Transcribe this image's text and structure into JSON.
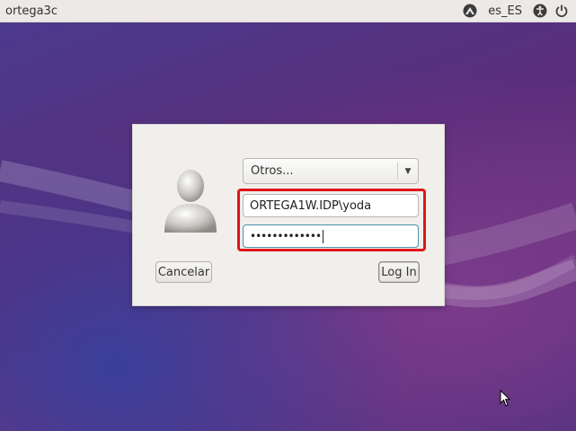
{
  "topbar": {
    "hostname": "ortega3c",
    "locale": "es_ES",
    "icons": [
      "network-icon",
      "accessibility-icon",
      "power-icon"
    ]
  },
  "login": {
    "session_select": "Otros...",
    "username_value": "ORTEGA1W.IDP\\yoda",
    "password_masked": "•••••••••••••",
    "cancel_label": "Cancelar",
    "login_label": "Log In"
  },
  "colors": {
    "highlight": "#e0151b",
    "panel_bg": "#ece9e6",
    "dialog_bg": "#f1efec"
  }
}
